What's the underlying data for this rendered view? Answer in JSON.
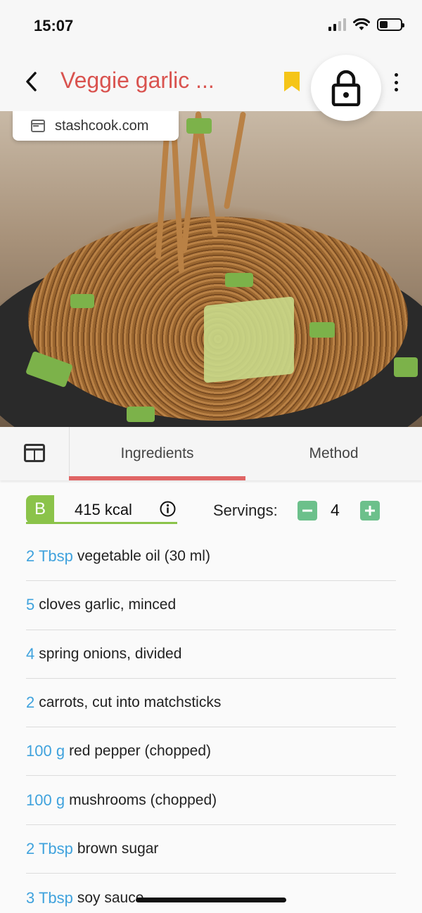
{
  "status_bar": {
    "time": "15:07"
  },
  "header": {
    "title": "Veggie garlic ..."
  },
  "hero": {
    "source": "stashcook.com"
  },
  "tabs": [
    {
      "label": "Ingredients"
    },
    {
      "label": "Method"
    }
  ],
  "nutrition": {
    "grade": "B",
    "kcal": "415 kcal",
    "servings_label": "Servings:",
    "servings": "4"
  },
  "ingredients": [
    {
      "qty": "2 Tbsp",
      "text": "vegetable oil (30 ml)"
    },
    {
      "qty": "5",
      "text": "cloves garlic, minced"
    },
    {
      "qty": "4",
      "text": "spring onions, divided"
    },
    {
      "qty": "2",
      "text": "carrots, cut into matchsticks"
    },
    {
      "qty": "100 g",
      "text": "red pepper (chopped)"
    },
    {
      "qty": "100 g",
      "text": "mushrooms (chopped)"
    },
    {
      "qty": "2 Tbsp",
      "text": "brown sugar"
    },
    {
      "qty": "3 Tbsp",
      "text": "soy sauce"
    }
  ],
  "colors": {
    "title": "#d9534f",
    "accent_tab": "#e06565",
    "quantity": "#3fa2dd",
    "grade": "#8bc34a",
    "stepper": "#6cc08b",
    "bookmark": "#f5c518"
  }
}
